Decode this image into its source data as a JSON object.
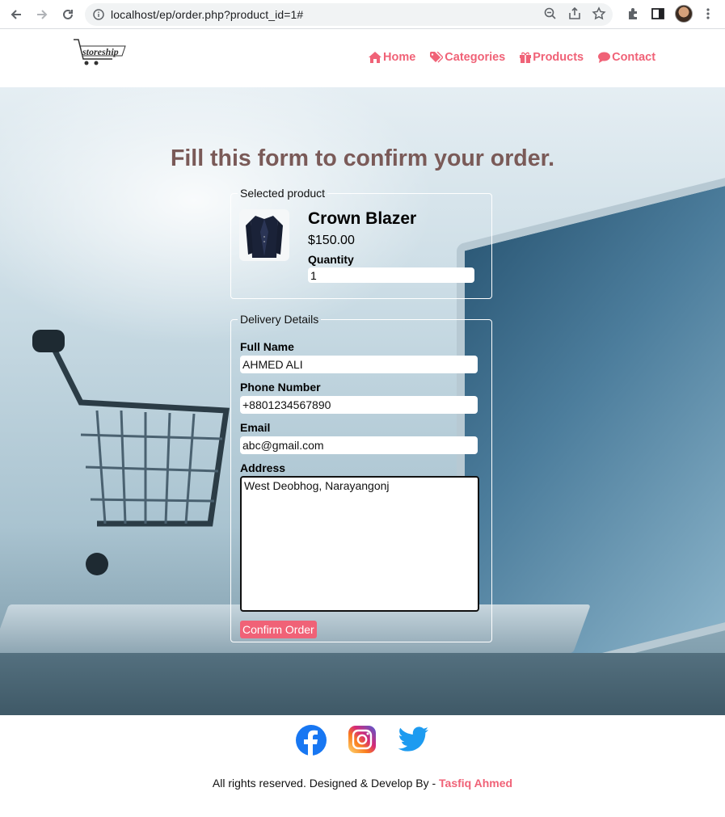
{
  "browser": {
    "url": "localhost/ep/order.php?product_id=1#",
    "icons": [
      "back-arrow-icon",
      "forward-arrow-icon",
      "reload-icon",
      "info-icon",
      "zoom-icon",
      "share-icon",
      "star-icon",
      "extensions-icon",
      "sidepanel-icon",
      "avatar",
      "more-icon"
    ]
  },
  "site": {
    "logo_text": "storeship",
    "nav": [
      {
        "label": "Home",
        "icon": "home-icon"
      },
      {
        "label": "Categories",
        "icon": "tags-icon"
      },
      {
        "label": "Products",
        "icon": "gift-icon"
      },
      {
        "label": "Contact",
        "icon": "comment-icon"
      }
    ],
    "accent": "#f06277"
  },
  "form": {
    "title": "Fill this form to confirm your order.",
    "product_legend": "Selected product",
    "product_name": "Crown Blazer",
    "product_price": "$150.00",
    "quantity_label": "Quantity",
    "quantity_value": "1",
    "delivery_legend": "Delivery Details",
    "full_name_label": "Full Name",
    "full_name_value": "AHMED ALI",
    "phone_label": "Phone Number",
    "phone_value": "+8801234567890",
    "email_label": "Email",
    "email_value": "abc@gmail.com",
    "address_label": "Address",
    "address_value": "West Deobhog, Narayangonj",
    "confirm_label": "Confirm Order"
  },
  "footer": {
    "social": [
      "facebook-icon",
      "instagram-icon",
      "twitter-icon"
    ],
    "text": "All rights reserved. Designed & Develop By -",
    "author": "Tasfiq Ahmed"
  }
}
